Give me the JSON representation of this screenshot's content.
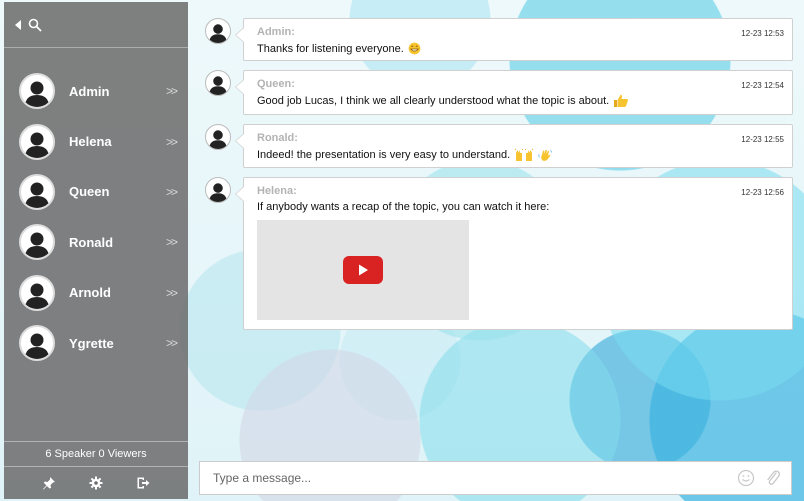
{
  "sidebar": {
    "users": [
      {
        "name": "Admin"
      },
      {
        "name": "Helena"
      },
      {
        "name": "Queen"
      },
      {
        "name": "Ronald"
      },
      {
        "name": "Arnold"
      },
      {
        "name": "Ygrette"
      }
    ],
    "footer_text": "6 Speaker 0 Viewers",
    "tools": [
      "pin-icon",
      "gear-icon",
      "logout-icon"
    ]
  },
  "messages": [
    {
      "sender": "Admin:",
      "time": "12-23 12:53",
      "text": "Thanks for listening everyone.",
      "emoji": "grin"
    },
    {
      "sender": "Queen:",
      "time": "12-23 12:54",
      "text": "Good job Lucas, I think we all clearly understood what the topic is about.",
      "emoji": "thumbs-up"
    },
    {
      "sender": "Ronald:",
      "time": "12-23 12:55",
      "text": "Indeed! the presentation is very easy to understand.",
      "emoji": "raised-hands, waving-hand"
    },
    {
      "sender": "Helena:",
      "time": "12-23 12:56",
      "text": "If anybody wants a recap of the topic, you can watch it here:",
      "emoji": "video"
    }
  ],
  "composer": {
    "placeholder": "Type a message..."
  },
  "colors": {
    "sidebar_bg": "#6e6e6e",
    "play_button": "#d92323",
    "sender_text": "#b3b3b3"
  }
}
